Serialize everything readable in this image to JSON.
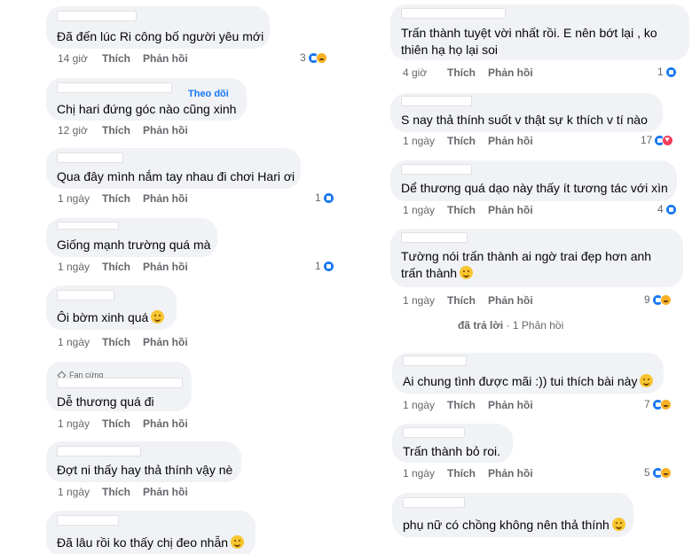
{
  "labels": {
    "like": "Thích",
    "reply": "Phản hồi"
  },
  "left_comments": [
    {
      "text": "Đã đến lúc Ri công bố người yêu mới",
      "time": "14 giờ",
      "count": "3"
    },
    {
      "text": "Chị hari đứng góc nào cũng xinh",
      "time": "12 giờ",
      "follow": "Theo dõi"
    },
    {
      "text": "Qua đây mình nắm tay nhau đi chơi Hari ơi",
      "time": "1 ngày",
      "count": "1"
    },
    {
      "text": "Giống mạnh trường quá mà",
      "time": "1 ngày",
      "count": "1"
    },
    {
      "text": "Ôi bờm xinh quá",
      "time": "1 ngày"
    },
    {
      "text": "Dễ thương quá đi",
      "time": "1 ngày",
      "badge": "Fan cứng"
    },
    {
      "text": "Đợt ni thấy hay thả thính vậy nè",
      "time": "1 ngày"
    },
    {
      "text": "Đã lâu rồi ko thấy chị đeo nhẫn"
    }
  ],
  "right_comments": [
    {
      "text": "Trấn thành tuyệt vời nhất rồi. E nên bớt lại , ko thiên hạ họ lại soi",
      "time": "4 giờ",
      "count": "1"
    },
    {
      "text": "S nay thả thính suốt v thật sự k thích v tí nào",
      "time": "1 ngày",
      "count": "17"
    },
    {
      "text": "Dể thương quá dạo này thấy ít tương tác với xìn",
      "time": "1 ngày",
      "count": "4"
    },
    {
      "text": "Tường nói trấn thành ai ngờ trai đẹp hơn anh trấn thành",
      "time": "1 ngày",
      "count": "9"
    },
    {
      "text": "Ai chung tình được mãi :)) tui thích bài này",
      "time": "1 ngày",
      "count": "7"
    },
    {
      "text": "Trấn thành bỏ roi.",
      "time": "1 ngày",
      "count": "5"
    },
    {
      "text": "phụ nữ có chồng không nên thả thính"
    }
  ],
  "reply_summary": {
    "replied": "đã trả lời",
    "count": "· 1 Phản hồi"
  },
  "colors": {
    "bubble": "#f0f2f5",
    "meta": "#65676b",
    "link": "#1877f2",
    "like": "#1877f2",
    "love": "#f33e58",
    "haha": "#f7b125"
  },
  "icons": {
    "like": "like-icon",
    "love": "love-icon",
    "haha": "haha-icon",
    "care": "care-icon",
    "wow": "wow-icon",
    "emoji": "emoji-icon",
    "badge": "diamond-icon"
  }
}
